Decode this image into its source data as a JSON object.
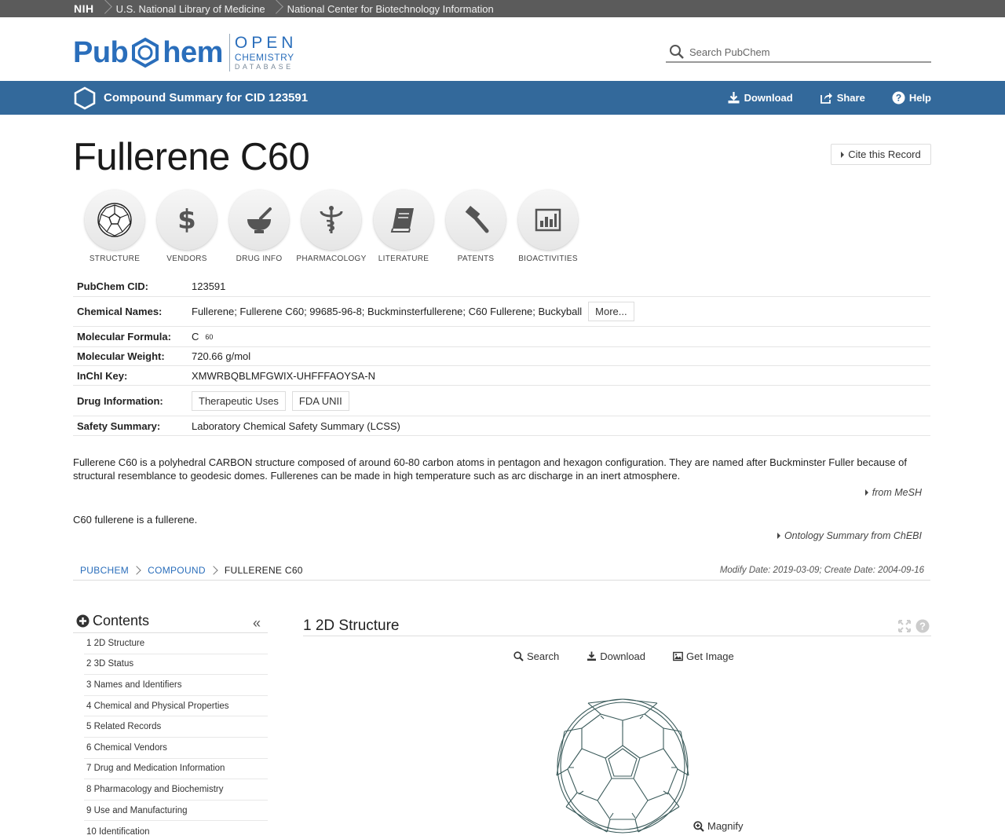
{
  "nih_bar": {
    "nih": "NIH",
    "nlm": "U.S. National Library of Medicine",
    "ncbi": "National Center for Biotechnology Information"
  },
  "header": {
    "logo_pub": "Pub",
    "logo_hem": "hem",
    "logo_open": "OPEN",
    "logo_chemistry": "CHEMISTRY",
    "logo_database": "DATABASE",
    "search_placeholder": "Search PubChem"
  },
  "compound_bar": {
    "title": "Compound Summary for CID 123591",
    "download": "Download",
    "share": "Share",
    "help": "Help"
  },
  "page": {
    "title": "Fullerene C60",
    "cite": "Cite this Record"
  },
  "icons": [
    {
      "label": "STRUCTURE",
      "icon": "buckyball-icon"
    },
    {
      "label": "VENDORS",
      "icon": "dollar-icon"
    },
    {
      "label": "DRUG INFO",
      "icon": "mortar-pestle-icon"
    },
    {
      "label": "PHARMACOLOGY",
      "icon": "caduceus-icon"
    },
    {
      "label": "LITERATURE",
      "icon": "book-icon"
    },
    {
      "label": "PATENTS",
      "icon": "gavel-icon"
    },
    {
      "label": "BIOACTIVITIES",
      "icon": "bar-chart-icon"
    }
  ],
  "info": {
    "cid_label": "PubChem CID:",
    "cid": "123591",
    "names_label": "Chemical Names:",
    "names": "Fullerene; Fullerene C60; 99685-96-8; Buckminsterfullerene; C60 Fullerene; Buckyball",
    "more": "More...",
    "formula_label": "Molecular Formula:",
    "formula_c": "C",
    "formula_sub": "60",
    "weight_label": "Molecular Weight:",
    "weight": "720.66 g/mol",
    "inchi_label": "InChI Key:",
    "inchi": "XMWRBQBLMFGWIX-UHFFFAOYSA-N",
    "drug_label": "Drug Information:",
    "drug_btn1": "Therapeutic Uses",
    "drug_btn2": "FDA UNII",
    "safety_label": "Safety Summary:",
    "safety": "Laboratory Chemical Safety Summary (LCSS)"
  },
  "description": {
    "mesh_text": "Fullerene C60 is a polyhedral CARBON structure composed of around 60-80 carbon atoms in pentagon and hexagon configuration. They are named after Buckminster Fuller because of structural resemblance to geodesic domes. Fullerenes can be made in high temperature such as arc discharge in an inert atmosphere.",
    "mesh_link": "from MeSH",
    "chebi_text": "C60 fullerene is a fullerene.",
    "chebi_link": "Ontology Summary from ChEBI"
  },
  "breadcrumb": {
    "items": [
      "PUBCHEM",
      "COMPOUND",
      "FULLERENE C60"
    ],
    "dates": "Modify Date: 2019-03-09; Create Date: 2004-09-16"
  },
  "contents": {
    "title": "Contents",
    "collapse": "«",
    "items": [
      "1 2D Structure",
      "2 3D Status",
      "3 Names and Identifiers",
      "4 Chemical and Physical Properties",
      "5 Related Records",
      "6 Chemical Vendors",
      "7 Drug and Medication Information",
      "8 Pharmacology and Biochemistry",
      "9 Use and Manufacturing",
      "10 Identification"
    ]
  },
  "section": {
    "title": "1  2D Structure",
    "search": "Search",
    "download": "Download",
    "get_image": "Get Image",
    "magnify": "Magnify"
  },
  "colors": {
    "accent_blue": "#33699b",
    "link_blue": "#2a6ebb",
    "nih_bar": "#5b5b5b"
  }
}
